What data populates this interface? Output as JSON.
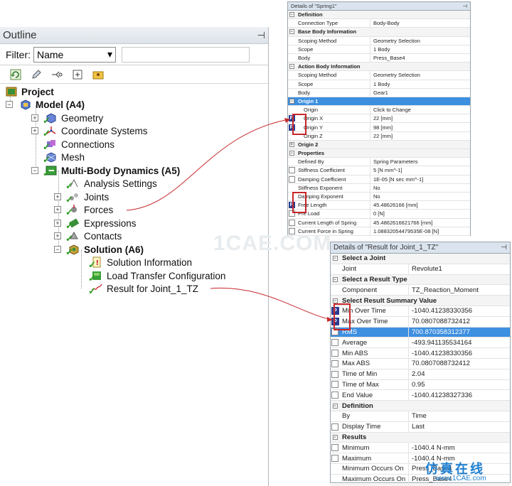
{
  "outline": {
    "title": "Outline",
    "filter_label": "Filter:",
    "filter_value": "Name",
    "tree": [
      {
        "label": "Project",
        "bold": true
      },
      {
        "label": "Model (A4)",
        "bold": true
      },
      {
        "label": "Geometry"
      },
      {
        "label": "Coordinate Systems"
      },
      {
        "label": "Connections"
      },
      {
        "label": "Mesh"
      },
      {
        "label": "Multi-Body Dynamics (A5)",
        "bold": true
      },
      {
        "label": "Analysis Settings"
      },
      {
        "label": "Joints"
      },
      {
        "label": "Forces"
      },
      {
        "label": "Expressions"
      },
      {
        "label": "Contacts"
      },
      {
        "label": "Solution (A6)",
        "bold": true
      },
      {
        "label": "Solution Information"
      },
      {
        "label": "Load Transfer Configuration"
      },
      {
        "label": "Result for Joint_1_TZ"
      }
    ]
  },
  "details_spring": {
    "title": "Details of \"Spring1\"",
    "rows": [
      {
        "type": "section",
        "k": "Definition"
      },
      {
        "k": "Connection Type",
        "v": "Body-Body"
      },
      {
        "type": "section",
        "k": "Base Body Information"
      },
      {
        "k": "Scoping Method",
        "v": "Geometry Selection"
      },
      {
        "k": "Scope",
        "v": "1 Body"
      },
      {
        "k": "Body",
        "v": "Press_Base4"
      },
      {
        "type": "section",
        "k": "Action Body Information"
      },
      {
        "k": "Scoping Method",
        "v": "Geometry Selection"
      },
      {
        "k": "Scope",
        "v": "1 Body"
      },
      {
        "k": "Body",
        "v": "Gear1"
      },
      {
        "type": "selected",
        "k": "Origin 1"
      },
      {
        "k": "Origin",
        "v": "Click to Change",
        "indent": true
      },
      {
        "k": "Origin X",
        "v": "22 [mm]",
        "p": true,
        "indent": true
      },
      {
        "k": "Origin Y",
        "v": "98 [mm]",
        "p": true,
        "indent": true
      },
      {
        "k": "Origin Z",
        "v": "22 [mm]",
        "indent": true
      },
      {
        "type": "section",
        "k": "Origin 2",
        "plus": true
      },
      {
        "type": "section",
        "k": "Properties"
      },
      {
        "k": "Defined By",
        "v": "Spring Parameters"
      },
      {
        "k": "Stiffness Coefficient",
        "v": "5 [N mm^-1]",
        "cb": true
      },
      {
        "k": "Damping Coefficient",
        "v": "1E-05 [N sec mm^-1]",
        "cb": true
      },
      {
        "k": "Stiffness Exponent",
        "v": "No"
      },
      {
        "k": "Damping Exponent",
        "v": "No"
      },
      {
        "k": "Free Length",
        "v": "45.48626166 [mm]",
        "p": true
      },
      {
        "k": "Pre Load",
        "v": "0 [N]",
        "cb": true
      },
      {
        "k": "Current Length of Spring",
        "v": "45.4862616621766 [mm]",
        "cb": true
      },
      {
        "k": "Current Force in Spring",
        "v": "1.08832054479535E-08 [N]",
        "cb": true
      }
    ]
  },
  "details_result": {
    "title": "Details of \"Result for Joint_1_TZ\"",
    "rows": [
      {
        "type": "section",
        "k": "Select a Joint"
      },
      {
        "k": "Joint",
        "v": "Revolute1"
      },
      {
        "type": "section",
        "k": "Select a Result Type"
      },
      {
        "k": "Component",
        "v": "TZ_Reaction_Moment"
      },
      {
        "type": "section",
        "k": "Select Result Summary Value"
      },
      {
        "k": "Min Over Time",
        "v": "-1040.41238330356",
        "p": true
      },
      {
        "k": "Max Over Time",
        "v": "70.0807088732412",
        "p": true
      },
      {
        "k": "RMS",
        "v": "700.870358312377",
        "cb": true,
        "sel": true
      },
      {
        "k": "Average",
        "v": "-493.941135534164",
        "cb": true
      },
      {
        "k": "Min ABS",
        "v": "-1040.41238330356",
        "cb": true
      },
      {
        "k": "Max ABS",
        "v": "70.0807088732412",
        "cb": true
      },
      {
        "k": "Time of Min",
        "v": "2.04",
        "cb": true
      },
      {
        "k": "Time of Max",
        "v": "0.95",
        "cb": true
      },
      {
        "k": "End Value",
        "v": "-1040.41238327336",
        "cb": true
      },
      {
        "type": "section",
        "k": "Definition"
      },
      {
        "k": "By",
        "v": "Time"
      },
      {
        "k": "Display Time",
        "v": "Last",
        "cb": true
      },
      {
        "type": "section",
        "k": "Results"
      },
      {
        "k": "Minimum",
        "v": "-1040.4 N-mm",
        "cb": true
      },
      {
        "k": "Maximum",
        "v": "-1040.4 N-mm",
        "cb": true
      },
      {
        "k": "Minimum Occurs On",
        "v": "Press_Base4"
      },
      {
        "k": "Maximum Occurs On",
        "v": "Press_Base4"
      }
    ]
  },
  "watermark": {
    "center": "1CAE.COM",
    "corner_cn": "仿真在线",
    "corner_url": "www.1CAE.com"
  },
  "colors": {
    "accent": "#3d8fe0",
    "red_box": "#c8262b",
    "p_badge": "#2b3c8f",
    "check": "#2a9b1e"
  }
}
